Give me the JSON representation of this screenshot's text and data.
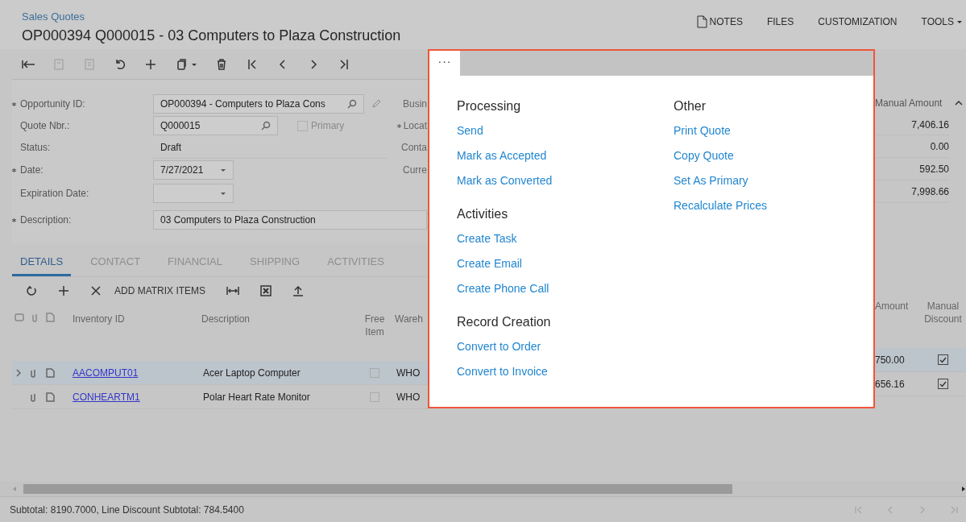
{
  "breadcrumb": "Sales Quotes",
  "title": "OP000394 Q000015 - 03 Computers to Plaza Construction",
  "header_actions": [
    {
      "kind": "notes",
      "label": "NOTES"
    },
    {
      "kind": "plain",
      "label": "FILES"
    },
    {
      "kind": "plain",
      "label": "CUSTOMIZATION"
    },
    {
      "kind": "dropdown",
      "label": "TOOLS"
    }
  ],
  "toolbar": [
    {
      "kind": "back",
      "disabled": false
    },
    {
      "kind": "save",
      "disabled": true
    },
    {
      "kind": "save-close",
      "disabled": true
    },
    {
      "kind": "undo",
      "disabled": false
    },
    {
      "kind": "add",
      "disabled": false
    },
    {
      "kind": "copy",
      "disabled": false
    },
    {
      "kind": "delete",
      "disabled": false
    },
    {
      "kind": "first",
      "disabled": false
    },
    {
      "kind": "prev",
      "disabled": false
    },
    {
      "kind": "next",
      "disabled": false
    },
    {
      "kind": "last",
      "disabled": false
    }
  ],
  "form": {
    "fields": [
      {
        "label": "Opportunity ID:",
        "required": true,
        "kind": "lookup",
        "value": "OP000394 - Computers to Plaza Cons"
      },
      {
        "label": "Quote Nbr.:",
        "required": false,
        "kind": "lookup",
        "value": "Q000015"
      },
      {
        "label": "Status:",
        "required": false,
        "kind": "text",
        "value": "Draft"
      },
      {
        "label": "Date:",
        "required": true,
        "kind": "date",
        "value": "7/27/2021"
      },
      {
        "label": "Expiration Date:",
        "required": false,
        "kind": "date"
      },
      {
        "label": "Description:",
        "required": true,
        "kind": "input",
        "value": "03 Computers to Plaza Construction"
      }
    ],
    "primary": {
      "label": "Primary",
      "checked": false
    },
    "column_2_labels": [
      {
        "label": "Busin",
        "required": false
      },
      {
        "label": "Locat",
        "required": true
      },
      {
        "label": "Conta",
        "required": false
      },
      {
        "label": "Curre",
        "required": false
      }
    ],
    "summary": {
      "header": "Manual Amount",
      "values": [
        "7,406.16",
        "0.00",
        "592.50",
        "7,998.66"
      ]
    }
  },
  "tabs": [
    {
      "label": "DETAILS",
      "selected": true
    },
    {
      "label": "CONTACT",
      "selected": false
    },
    {
      "label": "FINANCIAL",
      "selected": false
    },
    {
      "label": "SHIPPING",
      "selected": false
    },
    {
      "label": "ACTIVITIES",
      "selected": false
    }
  ],
  "grid_toolbar": {
    "add_matrix_items": "ADD MATRIX ITEMS"
  },
  "table": {
    "columns": [
      "Inventory ID",
      "Description",
      "Free Item",
      "Wareh",
      "Amount",
      "Manual Discount"
    ],
    "rows": [
      {
        "selected": true,
        "inventory_id": "AACOMPUT01",
        "description": "Acer Laptop Computer",
        "free_item": false,
        "warehouse": "WHO",
        "amount": "750.00",
        "manual_discount": true
      },
      {
        "selected": false,
        "inventory_id": "CONHEARTM1",
        "description": "Polar Heart Rate Monitor",
        "free_item": false,
        "warehouse": "WHO",
        "amount": "656.16",
        "manual_discount": true
      }
    ]
  },
  "status_bar": "Subtotal: 8190.7000, Line Discount Subtotal: 784.5400",
  "menu": {
    "tab": "···",
    "columns": [
      [
        {
          "title": "Processing",
          "items": [
            "Send",
            "Mark as Accepted",
            "Mark as Converted"
          ]
        },
        {
          "title": "Activities",
          "items": [
            "Create Task",
            "Create Email",
            "Create Phone Call"
          ]
        },
        {
          "title": "Record Creation",
          "items": [
            "Convert to Order",
            "Convert to Invoice"
          ]
        }
      ],
      [
        {
          "title": "Other",
          "items": [
            "Print Quote",
            "Copy Quote",
            "Set As Primary",
            "Recalculate Prices"
          ]
        }
      ]
    ]
  }
}
